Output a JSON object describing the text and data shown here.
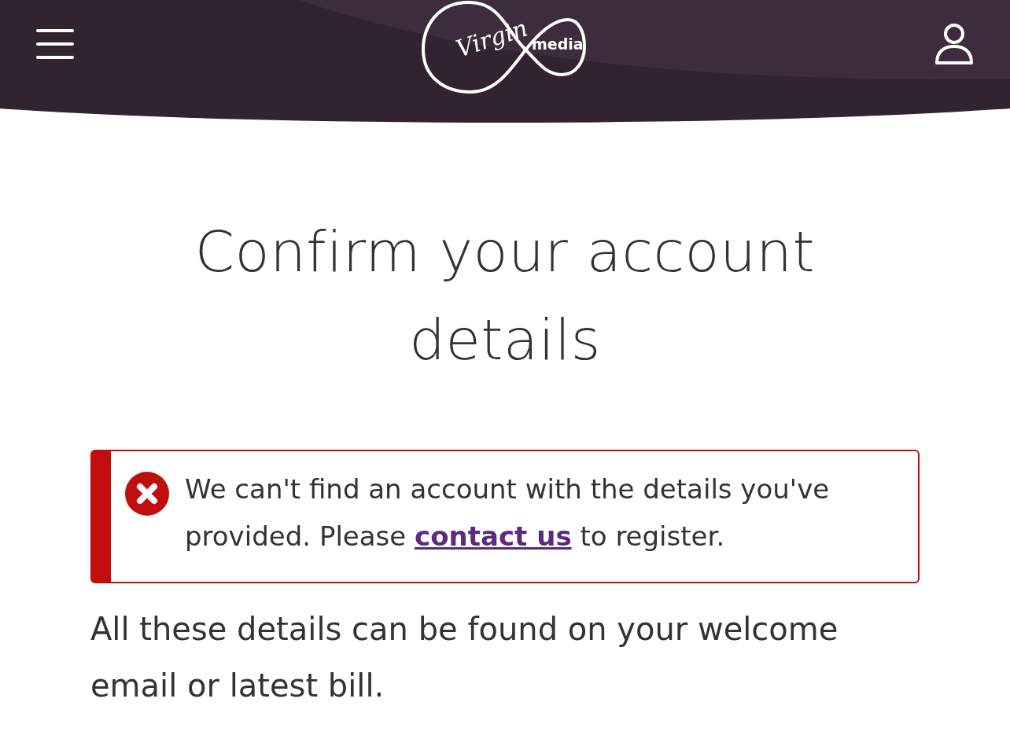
{
  "header": {
    "logo": {
      "script": "Virgin",
      "word": "media"
    }
  },
  "title": "Confirm your account details",
  "error": {
    "kind": "error",
    "text_before": "We can't find an account with the details you've provided. Please ",
    "link": "contact us",
    "text_after": " to register."
  },
  "body": "All these details can be found on your welcome email or latest bill."
}
